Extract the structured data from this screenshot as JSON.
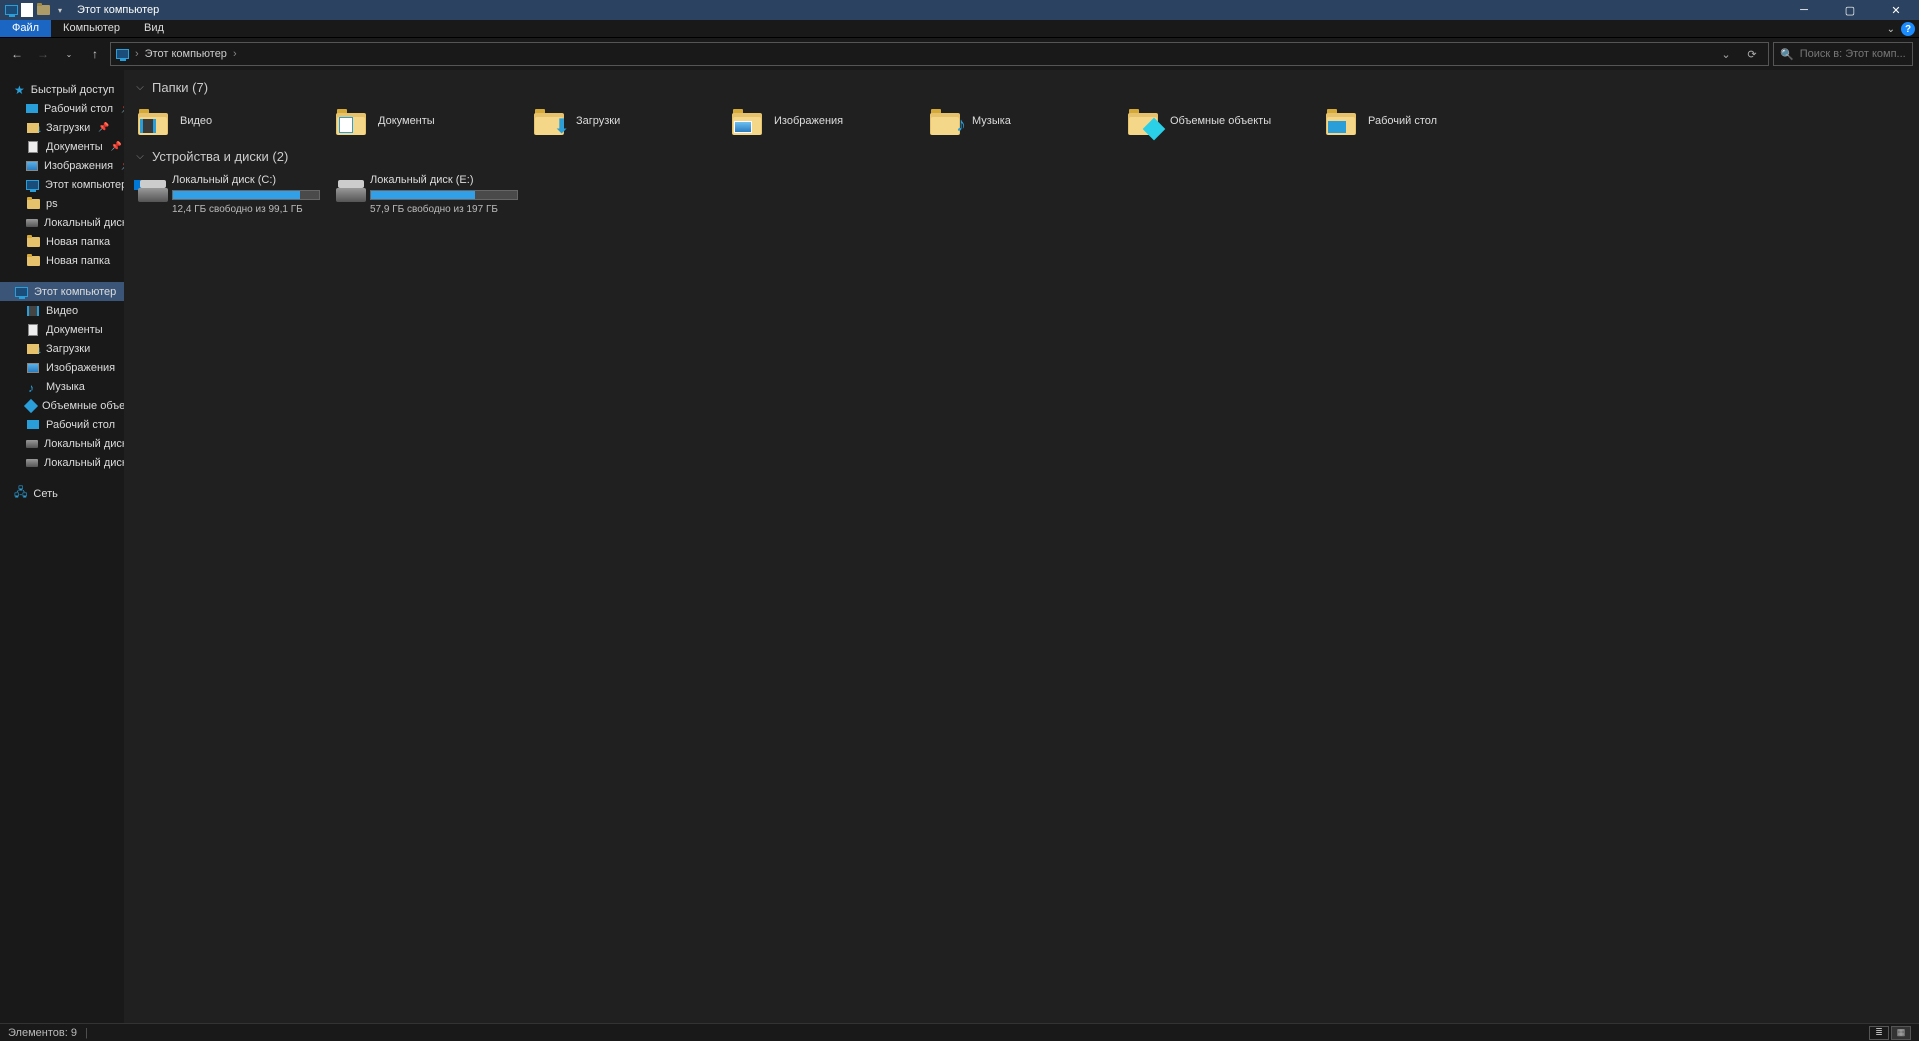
{
  "title": "Этот компьютер",
  "menu": {
    "file": "Файл",
    "computer": "Компьютер",
    "view": "Вид"
  },
  "address": {
    "location": "Этот компьютер"
  },
  "search": {
    "placeholder": "Поиск в: Этот комп..."
  },
  "tree": {
    "quick_access": "Быстрый доступ",
    "quick_items": [
      {
        "label": "Рабочий стол",
        "icon": "desktop",
        "pinned": true
      },
      {
        "label": "Загрузки",
        "icon": "download",
        "pinned": true
      },
      {
        "label": "Документы",
        "icon": "doc",
        "pinned": true
      },
      {
        "label": "Изображения",
        "icon": "pic",
        "pinned": true
      },
      {
        "label": "Этот компьютер",
        "icon": "monitor",
        "pinned": false
      },
      {
        "label": "ps",
        "icon": "folder",
        "pinned": false
      },
      {
        "label": "Локальный диск (E",
        "icon": "drive",
        "pinned": false
      },
      {
        "label": "Новая папка",
        "icon": "folder",
        "pinned": false
      },
      {
        "label": "Новая папка",
        "icon": "folder",
        "pinned": false
      }
    ],
    "this_pc": "Этот компьютер",
    "pc_items": [
      {
        "label": "Видео",
        "icon": "video"
      },
      {
        "label": "Документы",
        "icon": "doc"
      },
      {
        "label": "Загрузки",
        "icon": "download"
      },
      {
        "label": "Изображения",
        "icon": "pic"
      },
      {
        "label": "Музыка",
        "icon": "music"
      },
      {
        "label": "Объемные объекты",
        "icon": "3d"
      },
      {
        "label": "Рабочий стол",
        "icon": "desktop"
      },
      {
        "label": "Локальный диск (C",
        "icon": "drive"
      },
      {
        "label": "Локальный диск (E",
        "icon": "drive"
      }
    ],
    "network": "Сеть"
  },
  "groups": {
    "folders_header": "Папки (7)",
    "folders": [
      {
        "label": "Видео",
        "overlay": "video"
      },
      {
        "label": "Документы",
        "overlay": "doc"
      },
      {
        "label": "Загрузки",
        "overlay": "download"
      },
      {
        "label": "Изображения",
        "overlay": "pic"
      },
      {
        "label": "Музыка",
        "overlay": "music"
      },
      {
        "label": "Объемные объекты",
        "overlay": "3d"
      },
      {
        "label": "Рабочий стол",
        "overlay": "desktop"
      }
    ],
    "drives_header": "Устройства и диски (2)",
    "drives": [
      {
        "label": "Локальный диск (C:)",
        "free_text": "12,4 ГБ свободно из 99,1 ГБ",
        "used_pct": 87,
        "has_win": true
      },
      {
        "label": "Локальный диск (E:)",
        "free_text": "57,9 ГБ свободно из 197 ГБ",
        "used_pct": 71,
        "has_win": false
      }
    ]
  },
  "status": {
    "items": "Элементов: 9"
  }
}
